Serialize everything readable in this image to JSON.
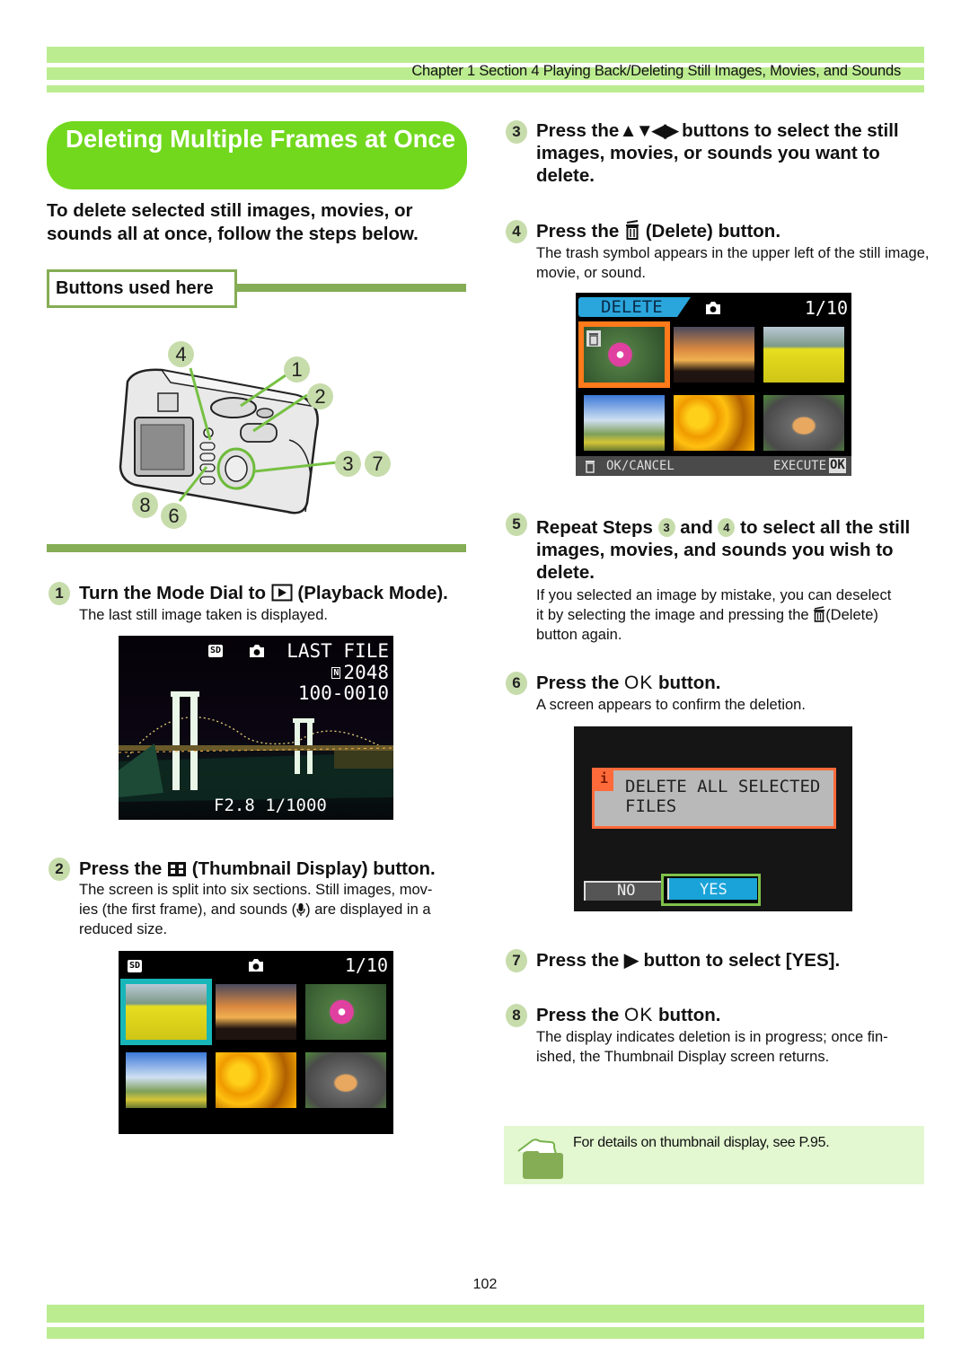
{
  "header": {
    "chapter_title": "Chapter 1 Section 4 Playing Back/Deleting Still Images, Movies, and Sounds"
  },
  "section": {
    "title": "Deleting Multiple Frames at Once",
    "intro": "To delete selected still images, movies, or sounds all at once, follow the steps below.",
    "buttons_used_label": "Buttons used here"
  },
  "camera_callouts": [
    "4",
    "1",
    "2",
    "3",
    "7",
    "8",
    "6"
  ],
  "steps": [
    {
      "num": "1",
      "head_before": "Turn the Mode Dial to ",
      "icon": "playback-icon",
      "head_after": " (Playback Mode).",
      "body": "The last still image taken is displayed."
    },
    {
      "num": "2",
      "head_before": "Press the ",
      "icon": "thumbnail-display-icon",
      "head_after": " (Thumbnail Display) button.",
      "body_line1": "The screen is split into six sections. Still images, mov-",
      "body_line2_before": "ies (the first frame), and sounds (",
      "body_line2_icon": "microphone-icon",
      "body_line2_after": ") are displayed in a",
      "body_line3": "reduced size."
    },
    {
      "num": "3",
      "head_before": "Press the",
      "icon": "arrow-buttons-icon",
      "head_arrows": "▲▼◀▶",
      "head_after": " buttons to select the still images, movies, or sounds you want to delete."
    },
    {
      "num": "4",
      "head_before": "Press the ",
      "icon": "trash-icon",
      "head_after": " (Delete) button.",
      "body": "The trash symbol appears in the upper left of the still image, movie, or sound."
    },
    {
      "num": "5",
      "head_part1": "Repeat Steps ",
      "ref_a": "3",
      "head_part2": " and ",
      "ref_b": "4",
      "head_part3": " to select all the still images, movies, and sounds you wish to delete.",
      "body_line1": "If you selected an image by mistake, you can deselect",
      "body_line2_before": "it by selecting the image and pressing the ",
      "body_line2_after": "(Delete)",
      "body_line3": "button again."
    },
    {
      "num": "6",
      "head_before": "Press the ",
      "ok_label": "OK",
      "head_after": " button.",
      "body": "A screen appears to confirm the deletion."
    },
    {
      "num": "7",
      "head_before": "Press the ",
      "icon": "right-arrow-icon",
      "head_arrow": "▶",
      "head_after": " button to select [YES]."
    },
    {
      "num": "8",
      "head_before": "Press the ",
      "ok_label": "OK",
      "head_after": " button.",
      "body_line1": "The display indicates deletion is in progress; once fin-",
      "body_line2": "ished, the Thumbnail Display screen returns."
    }
  ],
  "screen_playback": {
    "sd_label": "SD",
    "status_line1": "LAST FILE",
    "size_badge": "N",
    "status_line2": "2048",
    "status_line3": "100-0010",
    "exposure": "F2.8 1/1000"
  },
  "screen_thumbnails": {
    "sd_label": "SD",
    "counter": "1/10"
  },
  "screen_delete": {
    "mode_label": "DELETE",
    "counter": "1/10",
    "footer_left": "OK/CANCEL",
    "footer_right": "EXECUTE",
    "footer_ok": "OK"
  },
  "screen_confirm": {
    "info_badge": "i",
    "message_line1": "DELETE ALL SELECTED",
    "message_line2": "FILES",
    "no_label": "NO",
    "yes_label": "YES"
  },
  "note": {
    "text": "For details on thumbnail display, see P.95."
  },
  "footer": {
    "page_number": "102"
  },
  "colors": {
    "band": "#bbec90",
    "title_green": "#72d81e",
    "rule_green": "#85ad55",
    "step_badge": "#c7dcab",
    "note_bg": "#e3f7d1",
    "lcd_cyan": "#1aa9d6",
    "lcd_orange": "#ff7a1a"
  }
}
